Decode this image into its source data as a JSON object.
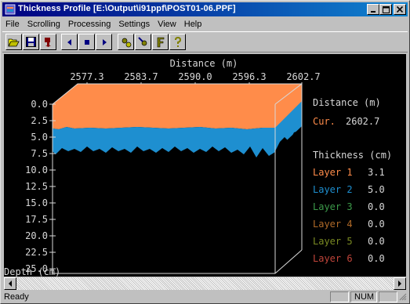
{
  "window": {
    "title": "Thickness Profile [E:\\Output\\i91ppf\\POST01-06.PPF]",
    "app_icon": "app-icon"
  },
  "menu": [
    "File",
    "Scrolling",
    "Processing",
    "Settings",
    "View",
    "Help"
  ],
  "toolbar": {
    "group1": [
      "open-icon",
      "save-icon",
      "export-icon"
    ],
    "group2": [
      "scroll-left-icon",
      "stop-icon",
      "scroll-right-icon"
    ],
    "group3": [
      "process-icon",
      "settings-icon",
      "filter-icon",
      "help-icon"
    ]
  },
  "plot": {
    "x_axis_title": "Distance (m)",
    "x_ticks": [
      "2577.3",
      "2583.7",
      "2590.0",
      "2596.3",
      "2602.7"
    ],
    "y_ticks": [
      "0.0",
      "2.5",
      "5.0",
      "7.5",
      "10.0",
      "12.5",
      "15.0",
      "17.5",
      "20.0",
      "22.5",
      "25.0"
    ],
    "y_axis_title": "Depth (cm)",
    "colors": {
      "layer1": "#ff8c4a",
      "layer2": "#1e8fd0",
      "background": "#000000",
      "text": "#d8d8d8"
    }
  },
  "readout": {
    "distance_header": "Distance (m)",
    "cur_label": "Cur.",
    "cur_value": "2602.7",
    "thickness_header": "Thickness (cm)",
    "layers": [
      {
        "label": "Layer 1",
        "value": "3.1",
        "color": "#ff8c4a"
      },
      {
        "label": "Layer 2",
        "value": "5.0",
        "color": "#1e8fd0"
      },
      {
        "label": "Layer 3",
        "value": "0.0",
        "color": "#3c9a4a"
      },
      {
        "label": "Layer 4",
        "value": "0.0",
        "color": "#b06a28"
      },
      {
        "label": "Layer 5",
        "value": "0.0",
        "color": "#7a8a22"
      },
      {
        "label": "Layer 6",
        "value": "0.0",
        "color": "#c0443a"
      }
    ]
  },
  "status": {
    "text": "Ready",
    "num": "NUM"
  }
}
